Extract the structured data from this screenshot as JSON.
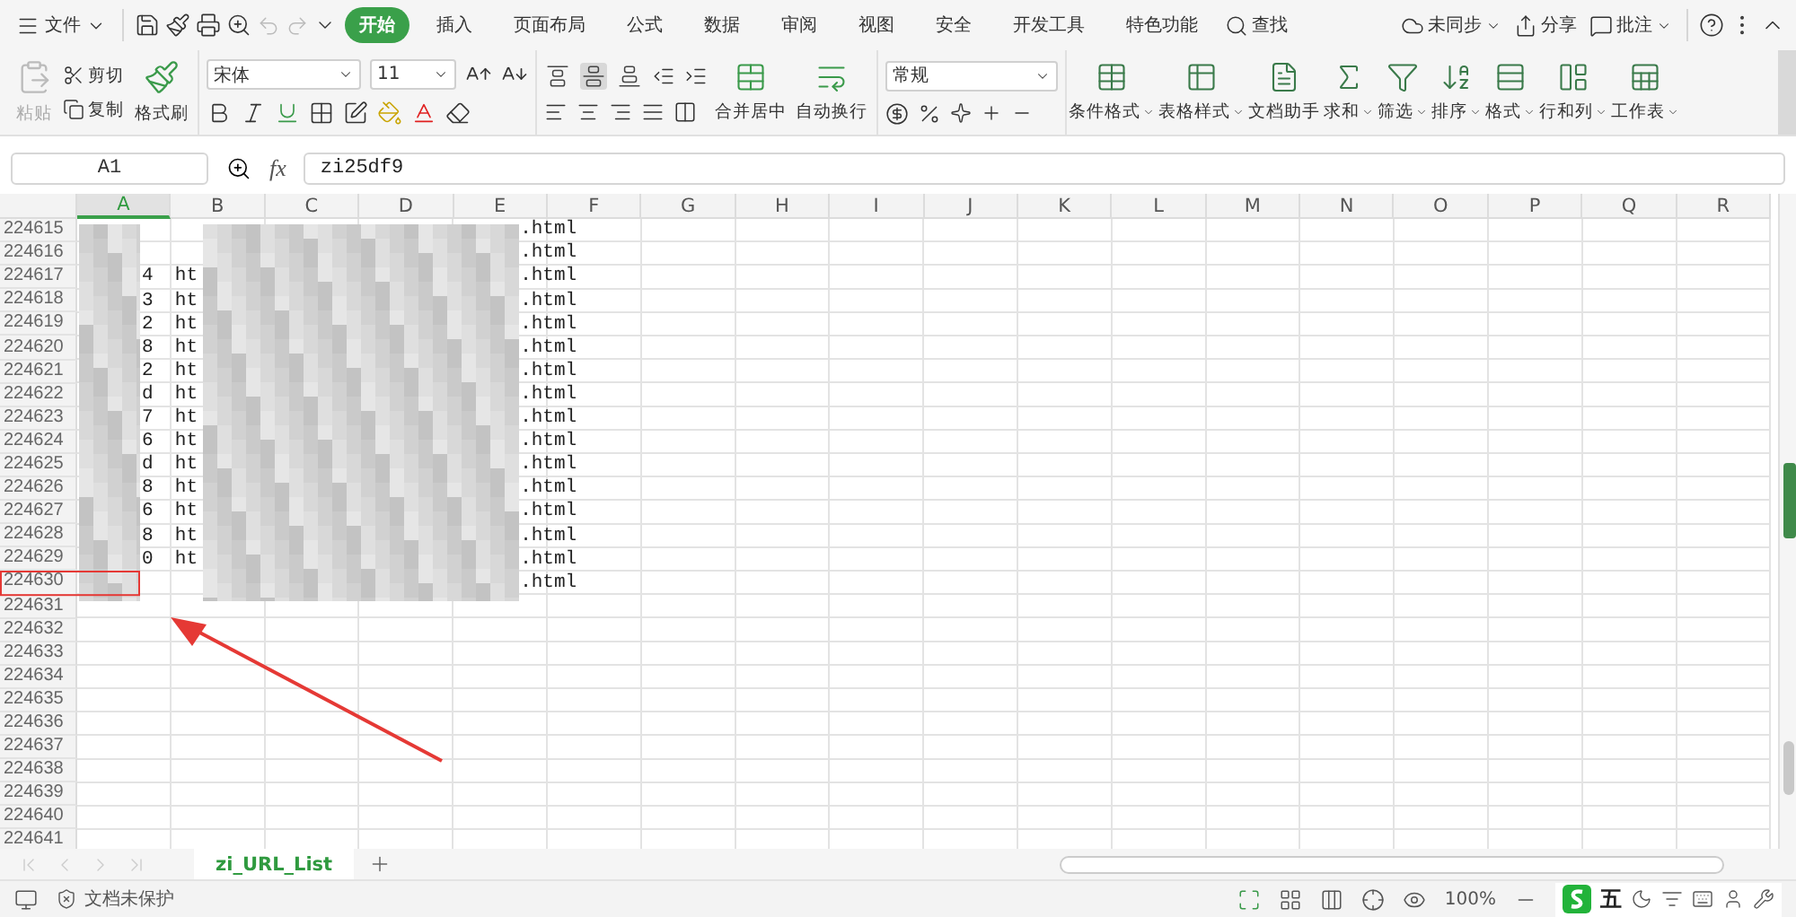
{
  "menu": {
    "label": "文件"
  },
  "tabs": [
    {
      "label": "开始",
      "selected": true
    },
    {
      "label": "插入",
      "selected": false
    },
    {
      "label": "页面布局",
      "selected": false
    },
    {
      "label": "公式",
      "selected": false
    },
    {
      "label": "数据",
      "selected": false
    },
    {
      "label": "审阅",
      "selected": false
    },
    {
      "label": "视图",
      "selected": false
    },
    {
      "label": "安全",
      "selected": false
    },
    {
      "label": "开发工具",
      "selected": false
    },
    {
      "label": "特色功能",
      "selected": false
    }
  ],
  "search": {
    "label": "查找"
  },
  "top_actions": [
    {
      "label": "未同步",
      "dropdown": true
    },
    {
      "label": "分享",
      "dropdown": false
    },
    {
      "label": "批注",
      "dropdown": true
    }
  ],
  "ribbon": {
    "paste": {
      "label": "粘贴",
      "disabled": true
    },
    "cut": "剪切",
    "copy": "复制",
    "format_painter": "格式刷",
    "font_name": "宋体",
    "font_size": "11",
    "merge": "合并居中",
    "wrap": "自动换行",
    "number_format": "常规",
    "large_buttons": [
      {
        "label": "条件格式",
        "kind": "conditional",
        "dropdown": true
      },
      {
        "label": "表格样式",
        "kind": "style",
        "dropdown": true
      },
      {
        "label": "文档助手",
        "kind": "assistant",
        "dropdown": false
      },
      {
        "label": "求和",
        "kind": "sum",
        "dropdown": true
      },
      {
        "label": "筛选",
        "kind": "filter",
        "dropdown": true
      },
      {
        "label": "排序",
        "kind": "sort",
        "dropdown": true
      },
      {
        "label": "格式",
        "kind": "format",
        "dropdown": true
      },
      {
        "label": "行和列",
        "kind": "rowcol",
        "dropdown": true
      },
      {
        "label": "工作表",
        "kind": "sheet",
        "dropdown": true
      }
    ]
  },
  "formula_bar": {
    "cell": "A1",
    "fx": "fx",
    "value": "zi25df9"
  },
  "columns": [
    {
      "label": "A",
      "selected": true
    },
    {
      "label": "B",
      "selected": false
    },
    {
      "label": "C",
      "selected": false
    },
    {
      "label": "D",
      "selected": false
    },
    {
      "label": "E",
      "selected": false
    },
    {
      "label": "F",
      "selected": false
    },
    {
      "label": "G",
      "selected": false
    },
    {
      "label": "H",
      "selected": false
    },
    {
      "label": "I",
      "selected": false
    },
    {
      "label": "J",
      "selected": false
    },
    {
      "label": "K",
      "selected": false
    },
    {
      "label": "L",
      "selected": false
    },
    {
      "label": "M",
      "selected": false
    },
    {
      "label": "N",
      "selected": false
    },
    {
      "label": "O",
      "selected": false
    },
    {
      "label": "P",
      "selected": false
    },
    {
      "label": "Q",
      "selected": false
    },
    {
      "label": "R",
      "selected": false
    }
  ],
  "rows": [
    {
      "number": "224615",
      "e": ".html"
    },
    {
      "number": "224616",
      "e": ".html"
    },
    {
      "number": "224617",
      "a": "4",
      "b": "ht",
      "e": ".html"
    },
    {
      "number": "224618",
      "a": "3",
      "b": "ht",
      "e": ".html"
    },
    {
      "number": "224619",
      "a": "2",
      "b": "ht",
      "e": ".html"
    },
    {
      "number": "224620",
      "a": "8",
      "b": "ht",
      "e": ".html"
    },
    {
      "number": "224621",
      "a": "2",
      "b": "ht",
      "e": ".html"
    },
    {
      "number": "224622",
      "a": "d",
      "b": "ht",
      "e": ".html"
    },
    {
      "number": "224623",
      "a": "7",
      "b": "ht",
      "e": ".html"
    },
    {
      "number": "224624",
      "a": "6",
      "b": "ht",
      "e": ".html"
    },
    {
      "number": "224625",
      "a": "d",
      "b": "ht",
      "e": ".html"
    },
    {
      "number": "224626",
      "a": "8",
      "b": "ht",
      "e": ".html"
    },
    {
      "number": "224627",
      "a": "6",
      "b": "ht",
      "e": ".html"
    },
    {
      "number": "224628",
      "a": "8",
      "b": "ht",
      "e": ".html"
    },
    {
      "number": "224629",
      "a": "0",
      "b": "ht",
      "e": ".html"
    },
    {
      "number": "224630",
      "e": ".html"
    },
    {
      "number": "224631"
    },
    {
      "number": "224632"
    },
    {
      "number": "224633"
    },
    {
      "number": "224634"
    },
    {
      "number": "224635"
    },
    {
      "number": "224636"
    },
    {
      "number": "224637"
    },
    {
      "number": "224638"
    },
    {
      "number": "224639"
    },
    {
      "number": "224640"
    },
    {
      "number": "224641"
    }
  ],
  "sheet_tabs": [
    {
      "label": "zi_URL_List",
      "selected": true
    }
  ],
  "status_bar": {
    "protection": "文档未保护",
    "zoom": "100%"
  },
  "ime": {
    "label": "五"
  }
}
